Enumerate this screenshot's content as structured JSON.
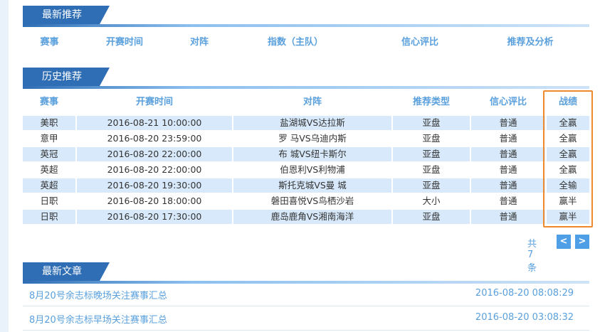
{
  "latest_recommend": {
    "title": "最新推荐",
    "columns": [
      "赛事",
      "开赛时间",
      "对阵",
      "指数（主队）",
      "信心评比",
      "推荐及分析"
    ]
  },
  "history_recommend": {
    "title": "历史推荐",
    "columns": [
      "赛事",
      "开赛时间",
      "对阵",
      "推荐类型",
      "信心评比",
      "战绩"
    ],
    "rows": [
      [
        "美职",
        "2016-08-21 10:00:00",
        "盐湖城VS达拉斯",
        "亚盘",
        "普通",
        "全赢"
      ],
      [
        "意甲",
        "2016-08-20 23:59:00",
        "罗 马VS乌迪内斯",
        "亚盘",
        "普通",
        "全赢"
      ],
      [
        "英冠",
        "2016-08-20 22:00:00",
        "布 城VS纽卡斯尔",
        "亚盘",
        "普通",
        "全赢"
      ],
      [
        "英超",
        "2016-08-20 22:00:00",
        "伯恩利VS利物浦",
        "亚盘",
        "普通",
        "全赢"
      ],
      [
        "英超",
        "2016-08-20 19:30:00",
        "斯托克城VS曼 城",
        "亚盘",
        "普通",
        "全输"
      ],
      [
        "日职",
        "2016-08-20 18:00:00",
        "磐田喜悦VS鸟栖沙岩",
        "大小",
        "普通",
        "赢半"
      ],
      [
        "日职",
        "2016-08-20 17:30:00",
        "鹿岛鹿角VS湘南海洋",
        "亚盘",
        "普通",
        "赢半"
      ]
    ],
    "total": "共7条",
    "prev": "<",
    "next": ">"
  },
  "latest_articles": {
    "title": "最新文章",
    "items": [
      {
        "title": "8月20号余志标晚场关注赛事汇总",
        "time": "2016-08-20 08:08:29"
      },
      {
        "title": "8月20号余志标早场关注赛事汇总",
        "time": "2016-08-20 03:08:32"
      }
    ]
  },
  "colors": {
    "accent": "#2f6eb5",
    "link": "#5aa0dd",
    "row_alt": "#d7e9fa",
    "highlight": "#ef8a2c"
  }
}
